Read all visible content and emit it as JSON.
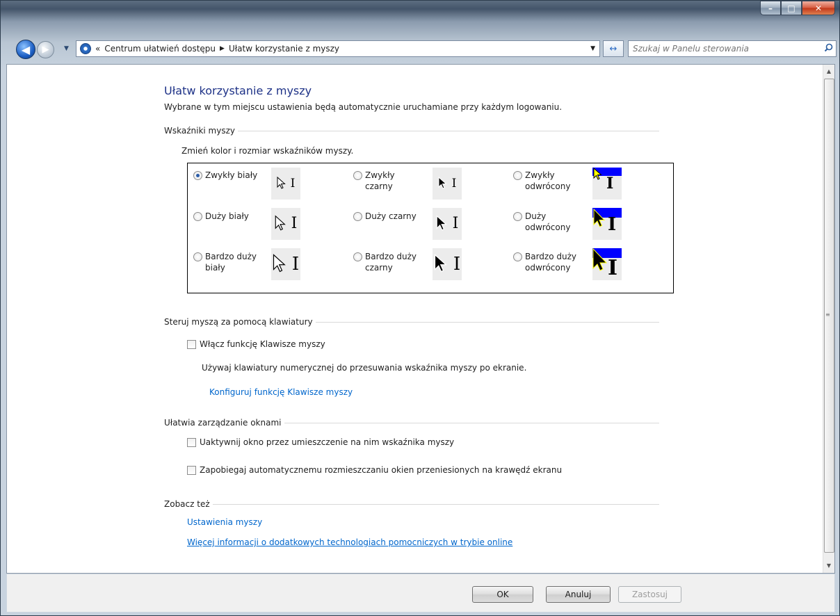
{
  "window": {
    "min_glyph": "–",
    "max_glyph": "□",
    "close_glyph": "✕"
  },
  "nav": {
    "back_glyph": "◀",
    "forward_glyph": "▶",
    "history_glyph": "▼",
    "breadcrumb_prefix": "«",
    "crumbs": [
      "Centrum ułatwień dostępu",
      "Ułatw korzystanie z myszy"
    ],
    "crumb_sep": "▶",
    "dropdown_glyph": "▼",
    "refresh_glyph": "↔",
    "search_placeholder": "Szukaj w Panelu sterowania"
  },
  "page": {
    "title": "Ułatw korzystanie z myszy",
    "subtitle": "Wybrane w tym miejscu ustawienia będą automatycznie uruchamiane przy każdym logowaniu.",
    "pointers": {
      "section": "Wskaźniki myszy",
      "description": "Zmień kolor i rozmiar wskaźników myszy.",
      "options": [
        {
          "label": "Zwykły biały",
          "selected": true
        },
        {
          "label": "Zwykły czarny",
          "selected": false
        },
        {
          "label": "Zwykły odwrócony",
          "selected": false
        },
        {
          "label": "Duży biały",
          "selected": false
        },
        {
          "label": "Duży czarny",
          "selected": false
        },
        {
          "label": "Duży odwrócony",
          "selected": false
        },
        {
          "label": "Bardzo duży biały",
          "selected": false
        },
        {
          "label": "Bardzo duży czarny",
          "selected": false
        },
        {
          "label": "Bardzo duży odwrócony",
          "selected": false
        }
      ]
    },
    "keyboard": {
      "section": "Steruj myszą za pomocą klawiatury",
      "checkbox": "Włącz funkcję Klawisze myszy",
      "checked": false,
      "description": "Używaj klawiatury numerycznej do przesuwania wskaźnika myszy po ekranie.",
      "link": "Konfiguruj funkcję Klawisze myszy"
    },
    "windows": {
      "section": "Ułatwia zarządzanie oknami",
      "checkbox1": "Uaktywnij okno przez umieszczenie na nim wskaźnika myszy",
      "checkbox2": "Zapobiegaj automatycznemu rozmieszczaniu okien przeniesionych na krawędź ekranu"
    },
    "see_also": {
      "section": "Zobacz też",
      "link1": "Ustawienia myszy",
      "link2": "Więcej informacji o dodatkowych technologiach pomocniczych w trybie online"
    }
  },
  "buttons": {
    "ok": "OK",
    "cancel": "Anuluj",
    "apply": "Zastosuj"
  },
  "colors": {
    "title": "#1e3287",
    "link": "#0066cc",
    "inverted_bg": "#0000ff",
    "inverted_fg": "#ffff00"
  }
}
